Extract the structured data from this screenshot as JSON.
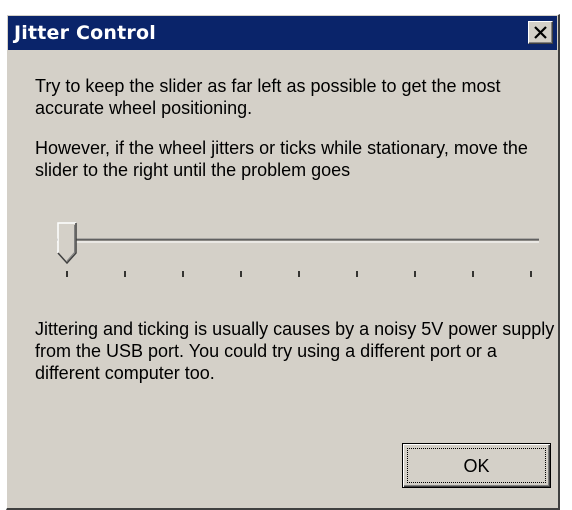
{
  "dialog": {
    "title": "Jitter Control",
    "close_icon": "close-icon",
    "paragraph1": "Try to keep the slider as far left as possible to get the most accurate wheel positioning.",
    "paragraph2": "However, if the wheel jitters or ticks while stationary, move the slider to the right until the problem goes",
    "paragraph3": "Jittering and ticking is usually causes by a noisy 5V power supply from the USB port. You could try using a different port or a different computer too.",
    "slider": {
      "value_fraction": 0.0,
      "tick_count": 9
    },
    "ok_label": "OK"
  },
  "colors": {
    "titlebar": "#0a246a",
    "title_text": "#ffffff",
    "face": "#d4d0c8"
  }
}
